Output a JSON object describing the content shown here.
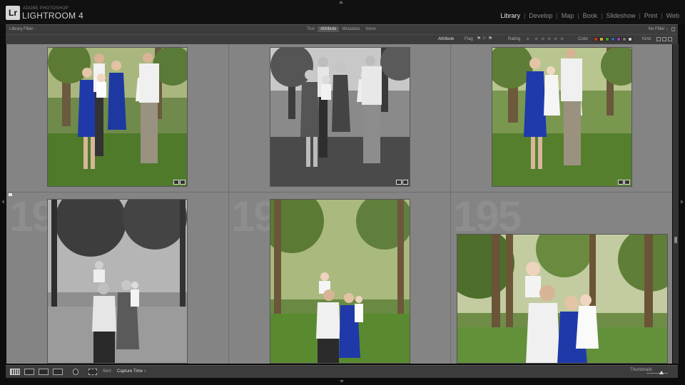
{
  "app": {
    "logo": "Lr",
    "brand_top": "ADOBE PHOTOSHOP",
    "brand_main": "LIGHTROOM 4"
  },
  "modules": [
    "Library",
    "Develop",
    "Map",
    "Book",
    "Slideshow",
    "Print",
    "Web"
  ],
  "active_module": "Library",
  "filter_bar": {
    "label": "Library Filter :",
    "tabs": [
      "Text",
      "Attribute",
      "Metadata",
      "None"
    ],
    "selected_tab": "Attribute",
    "preset": "No Filter ↓"
  },
  "attribute_bar": {
    "attribute_label": "Attribute",
    "flag_label": "Flag",
    "rating_label": "Rating",
    "rating_compare": "≥",
    "color_label": "Color",
    "kind_label": "Kind",
    "color_swatches": [
      "#c0392b",
      "#d4b02a",
      "#4a9a3a",
      "#3a62b0",
      "#8a4aa8",
      "#777777",
      "#cccccc"
    ]
  },
  "grid": {
    "cell_numbers": [
      "19",
      "19",
      "195"
    ],
    "photos": [
      {
        "name": "family-photo-color-1",
        "style": "color"
      },
      {
        "name": "family-photo-bw-1",
        "style": "bw"
      },
      {
        "name": "family-photo-color-2",
        "style": "color"
      },
      {
        "name": "family-photo-bw-2",
        "style": "bw"
      },
      {
        "name": "family-photo-color-3",
        "style": "color"
      },
      {
        "name": "family-photo-color-4",
        "style": "color"
      }
    ]
  },
  "toolbar": {
    "sort_label": "Sort:",
    "sort_value": "Capture Time ↕",
    "thumbnails_label": "Thumbnails"
  }
}
